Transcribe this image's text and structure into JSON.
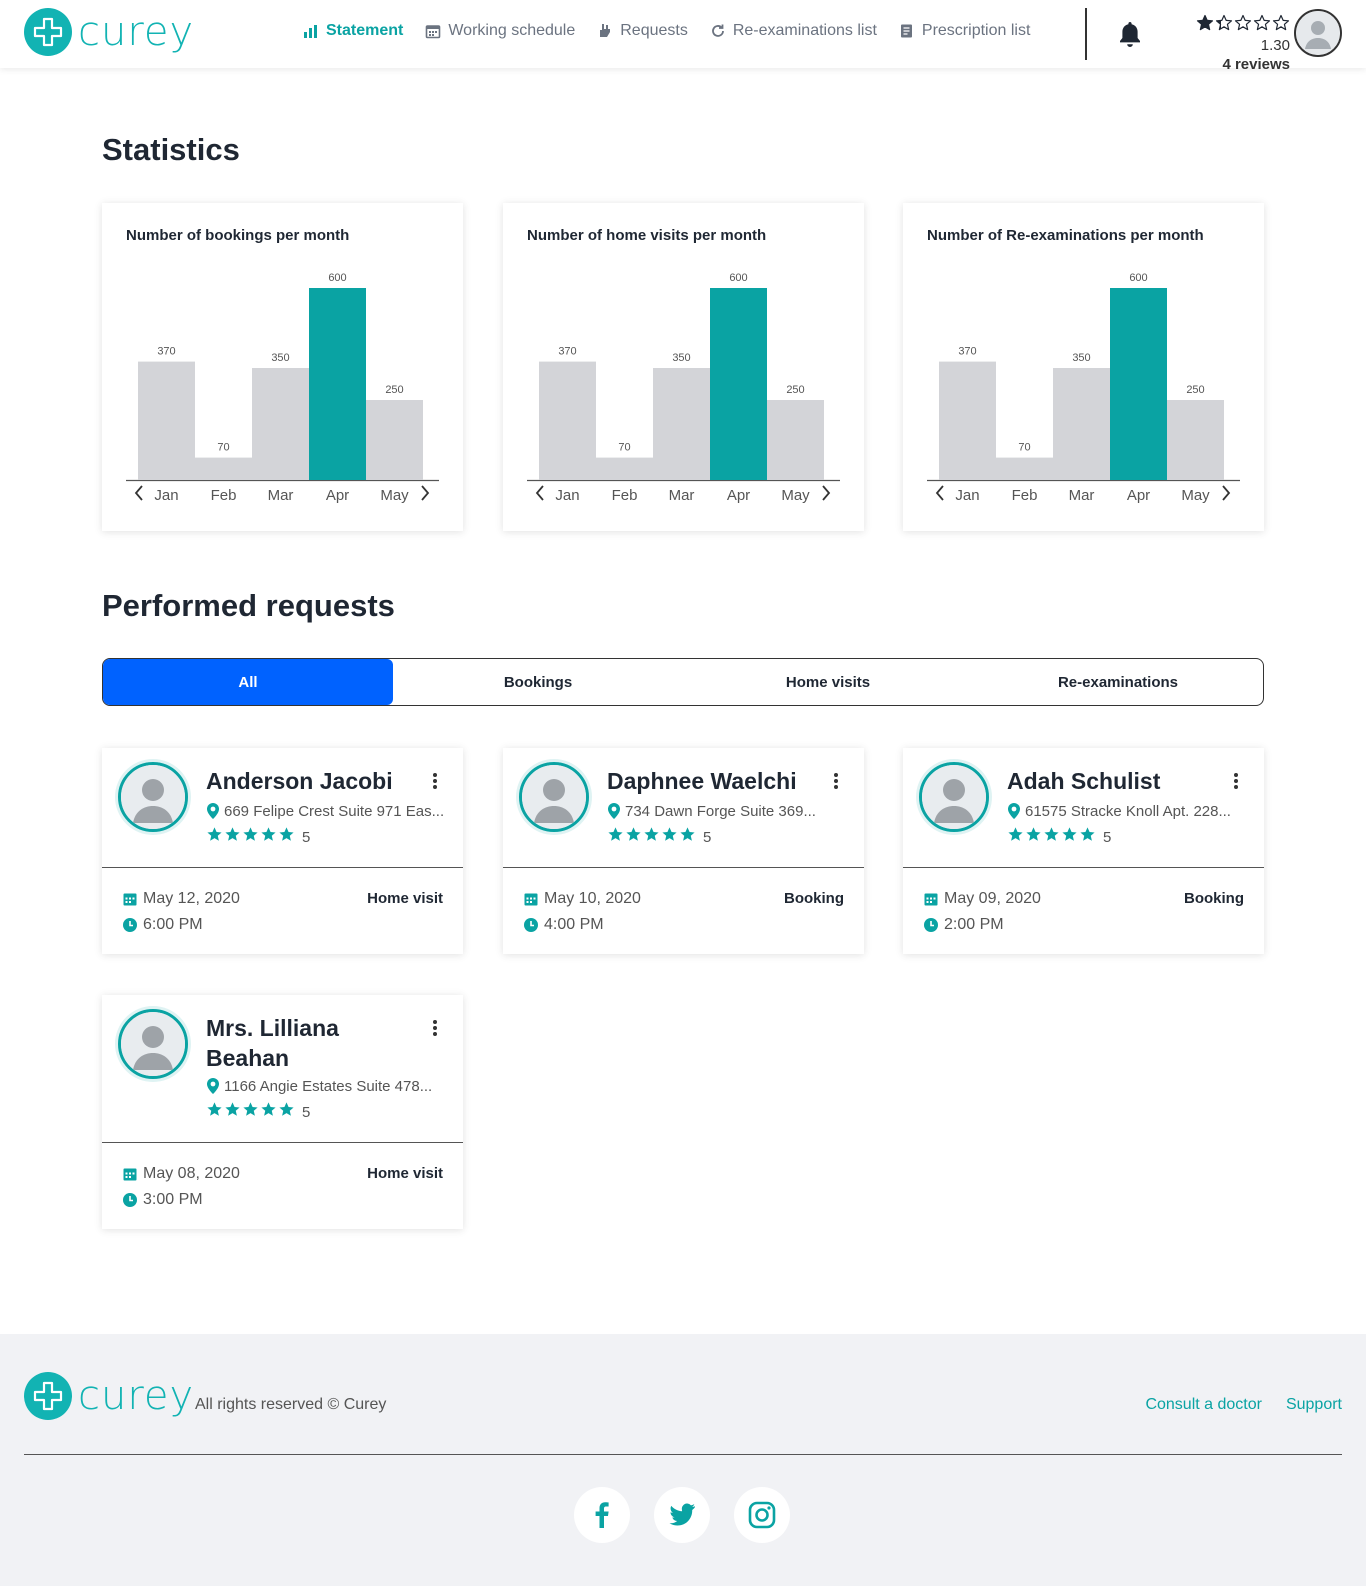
{
  "brand": {
    "name": "curey",
    "color": "#12b3b3"
  },
  "nav": {
    "items": [
      {
        "label": "Statement",
        "icon": "bar-chart-icon",
        "active": true
      },
      {
        "label": "Working schedule",
        "icon": "calendar-icon"
      },
      {
        "label": "Requests",
        "icon": "hand-icon"
      },
      {
        "label": "Re-examinations list",
        "icon": "refresh-icon"
      },
      {
        "label": "Prescription list",
        "icon": "prescription-icon"
      }
    ]
  },
  "user": {
    "rating": "1.30",
    "reviews": "4 reviews",
    "stars_filled": 1.3
  },
  "statistics": {
    "title": "Statistics",
    "charts": [
      {
        "title": "Number of bookings per month"
      },
      {
        "title": "Number of home visits per month"
      },
      {
        "title": "Number of Re-examinations per month"
      }
    ]
  },
  "chart_data": [
    {
      "type": "bar",
      "title": "Number of bookings per month",
      "categories": [
        "Jan",
        "Feb",
        "Mar",
        "Apr",
        "May"
      ],
      "values": [
        370,
        70,
        350,
        600,
        250
      ],
      "highlight": "Apr",
      "colors": {
        "bar": "#d3d4d8",
        "highlight": "#0aa3a3"
      }
    },
    {
      "type": "bar",
      "title": "Number of home visits per month",
      "categories": [
        "Jan",
        "Feb",
        "Mar",
        "Apr",
        "May"
      ],
      "values": [
        370,
        70,
        350,
        600,
        250
      ],
      "highlight": "Apr",
      "colors": {
        "bar": "#d3d4d8",
        "highlight": "#0aa3a3"
      }
    },
    {
      "type": "bar",
      "title": "Number of Re-examinations per month",
      "categories": [
        "Jan",
        "Feb",
        "Mar",
        "Apr",
        "May"
      ],
      "values": [
        370,
        70,
        350,
        600,
        250
      ],
      "highlight": "Apr",
      "colors": {
        "bar": "#d3d4d8",
        "highlight": "#0aa3a3"
      }
    }
  ],
  "requests": {
    "title": "Performed requests",
    "tabs": [
      "All",
      "Bookings",
      "Home visits",
      "Re-examinations"
    ],
    "active_tab": "All",
    "items": [
      {
        "name": "Anderson Jacobi",
        "address": "669 Felipe Crest Suite 971 Eas...",
        "score": "5",
        "date": "May 12, 2020",
        "time": "6:00 PM",
        "type": "Home visit"
      },
      {
        "name": "Daphnee Waelchi",
        "address": "734 Dawn Forge Suite 369...",
        "score": "5",
        "date": "May 10, 2020",
        "time": "4:00 PM",
        "type": "Booking"
      },
      {
        "name": "Adah Schulist",
        "address": "61575 Stracke Knoll Apt. 228...",
        "score": "5",
        "date": "May 09, 2020",
        "time": "2:00 PM",
        "type": "Booking"
      },
      {
        "name": "Mrs. Lilliana Beahan",
        "address": "1166 Angie Estates Suite 478...",
        "score": "5",
        "date": "May 08, 2020",
        "time": "3:00 PM",
        "type": "Home visit"
      }
    ]
  },
  "footer": {
    "copyright": "All rights reserved © Curey",
    "links": [
      "Consult a doctor",
      "Support"
    ],
    "socials": [
      "facebook-icon",
      "twitter-icon",
      "instagram-icon"
    ]
  }
}
